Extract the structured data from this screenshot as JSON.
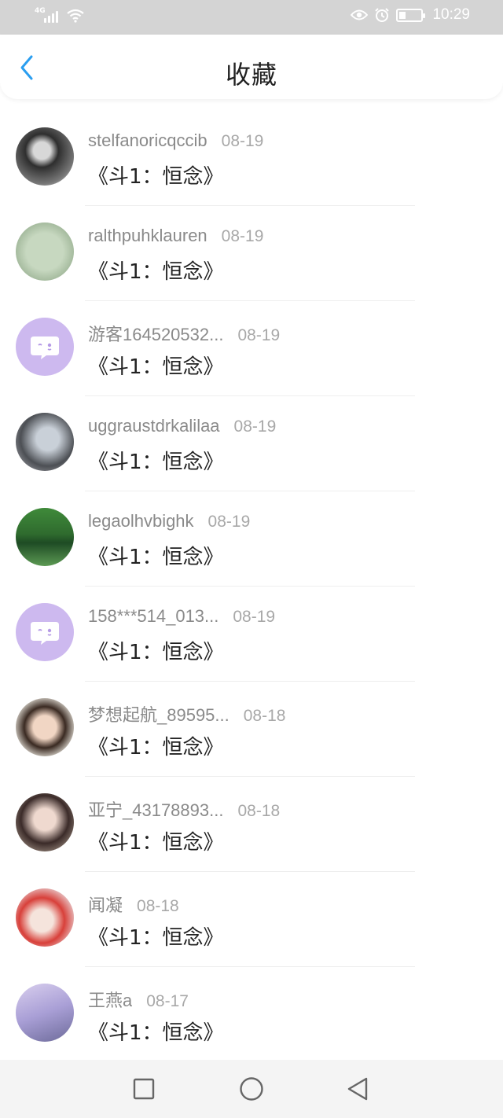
{
  "status_bar": {
    "network": "4G",
    "time": "10:29",
    "icons": [
      "signal-icon",
      "wifi-icon",
      "eye-icon",
      "alarm-icon",
      "battery-icon"
    ],
    "battery_level": 0.3
  },
  "header": {
    "title": "收藏",
    "back_icon": "chevron-left-icon",
    "accent_color": "#2a9ef0"
  },
  "favorites": [
    {
      "username": "stelfanoricqccib",
      "date": "08-19",
      "title": "《斗1：恒念》"
    },
    {
      "username": "ralthpuhklauren",
      "date": "08-19",
      "title": "《斗1：恒念》"
    },
    {
      "username": "游客164520532...",
      "date": "08-19",
      "title": "《斗1：恒念》"
    },
    {
      "username": "uggraustdrkalilaa",
      "date": "08-19",
      "title": "《斗1：恒念》"
    },
    {
      "username": "legaolhvbighk",
      "date": "08-19",
      "title": "《斗1：恒念》"
    },
    {
      "username": "158***514_013...",
      "date": "08-19",
      "title": "《斗1：恒念》"
    },
    {
      "username": "梦想起航_89595...",
      "date": "08-18",
      "title": "《斗1：恒念》"
    },
    {
      "username": "亚宁_43178893...",
      "date": "08-18",
      "title": "《斗1：恒念》"
    },
    {
      "username": "闻凝",
      "date": "08-18",
      "title": "《斗1：恒念》"
    },
    {
      "username": "王燕a",
      "date": "08-17",
      "title": "《斗1：恒念》"
    }
  ],
  "nav_bar": {
    "icons": [
      "recent-apps-icon",
      "home-icon",
      "back-triangle-icon"
    ]
  }
}
